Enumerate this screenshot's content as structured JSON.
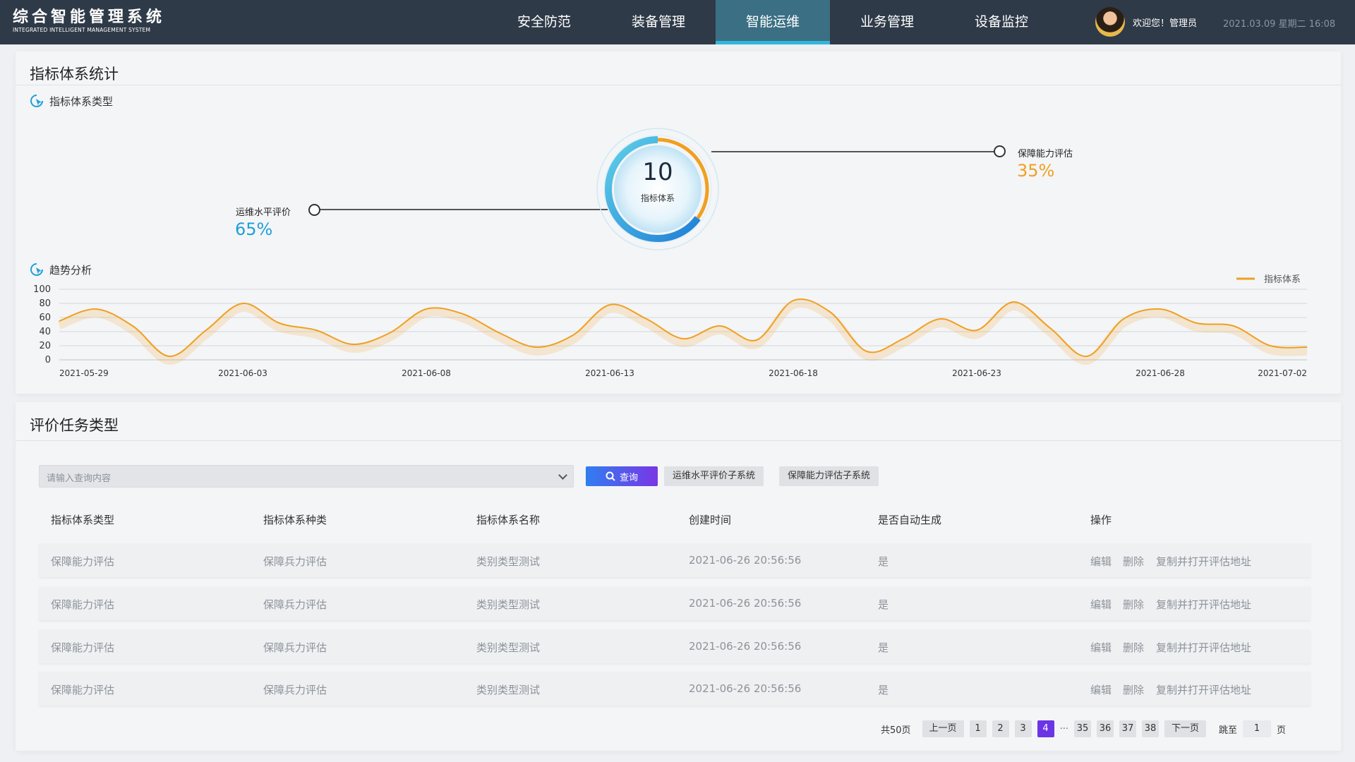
{
  "header": {
    "title": "综合智能管理系统",
    "subtitle": "INTEGRATED INTELLIGENT MANAGEMENT SYSTEM",
    "nav": [
      "安全防范",
      "装备管理",
      "智能运维",
      "业务管理",
      "设备监控"
    ],
    "active_nav": "智能运维",
    "welcome": "欢迎您！管理员",
    "datetime": "2021.03.09 星期二 16:08"
  },
  "stats": {
    "title": "指标体系统计",
    "type_section": "指标体系类型",
    "center_value": "10",
    "center_label": "指标体系",
    "segments": [
      {
        "name": "运维水平评价",
        "value": "65%",
        "percent": 65,
        "color": "#1ea0d8"
      },
      {
        "name": "保障能力评估",
        "value": "35%",
        "percent": 35,
        "color": "#f0a020"
      }
    ],
    "trend_section": "趋势分析"
  },
  "chart_data": {
    "type": "line",
    "title": "",
    "xlabel": "",
    "ylabel": "",
    "ylim": [
      0,
      100
    ],
    "yticks": [
      0,
      20,
      40,
      60,
      80,
      100
    ],
    "legend_position": "top-right",
    "x_tick_labels": [
      "2021-05-29",
      "2021-06-03",
      "2021-06-08",
      "2021-06-13",
      "2021-06-18",
      "2021-06-23",
      "2021-06-28",
      "2021-07-02"
    ],
    "series": [
      {
        "name": "指标体系",
        "color": "#f0a020",
        "x": [
          "2021-05-29",
          "2021-05-30",
          "2021-05-31",
          "2021-06-01",
          "2021-06-02",
          "2021-06-03",
          "2021-06-04",
          "2021-06-05",
          "2021-06-06",
          "2021-06-07",
          "2021-06-08",
          "2021-06-09",
          "2021-06-10",
          "2021-06-11",
          "2021-06-12",
          "2021-06-13",
          "2021-06-14",
          "2021-06-15",
          "2021-06-16",
          "2021-06-17",
          "2021-06-18",
          "2021-06-19",
          "2021-06-20",
          "2021-06-21",
          "2021-06-22",
          "2021-06-23",
          "2021-06-24",
          "2021-06-25",
          "2021-06-26",
          "2021-06-27",
          "2021-06-28",
          "2021-06-29",
          "2021-06-30",
          "2021-07-01",
          "2021-07-02"
        ],
        "values": [
          55,
          72,
          48,
          5,
          42,
          80,
          52,
          42,
          22,
          38,
          72,
          65,
          38,
          18,
          35,
          78,
          58,
          30,
          48,
          28,
          84,
          68,
          12,
          30,
          58,
          42,
          82,
          45,
          5,
          58,
          72,
          52,
          48,
          20,
          18
        ]
      }
    ]
  },
  "tasks": {
    "title": "评价任务类型",
    "search_placeholder": "请输入查询内容",
    "query_label": "查询",
    "filter_buttons": [
      "运维水平评价子系统",
      "保障能力评估子系统"
    ],
    "columns": [
      "指标体系类型",
      "指标体系种类",
      "指标体系名称",
      "创建时间",
      "是否自动生成",
      "操作"
    ],
    "rows": [
      {
        "type": "保障能力评估",
        "kind": "保障兵力评估",
        "name": "类别类型测试",
        "created": "2021-06-26   20:56:56",
        "auto": "是"
      },
      {
        "type": "保障能力评估",
        "kind": "保障兵力评估",
        "name": "类别类型测试",
        "created": "2021-06-26   20:56:56",
        "auto": "是"
      },
      {
        "type": "保障能力评估",
        "kind": "保障兵力评估",
        "name": "类别类型测试",
        "created": "2021-06-26   20:56:56",
        "auto": "是"
      },
      {
        "type": "保障能力评估",
        "kind": "保障兵力评估",
        "name": "类别类型测试",
        "created": "2021-06-26   20:56:56",
        "auto": "是"
      }
    ],
    "row_actions": [
      "编辑",
      "删除",
      "复制并打开评估地址"
    ]
  },
  "pagination": {
    "total": "共50页",
    "prev": "上一页",
    "pages_before": [
      "1",
      "2",
      "3"
    ],
    "current": "4",
    "ellipsis": "···",
    "pages_after": [
      "35",
      "36",
      "37",
      "38"
    ],
    "next": "下一页",
    "jump_label": "跳至",
    "jump_value": "1",
    "page_suffix": "页"
  }
}
